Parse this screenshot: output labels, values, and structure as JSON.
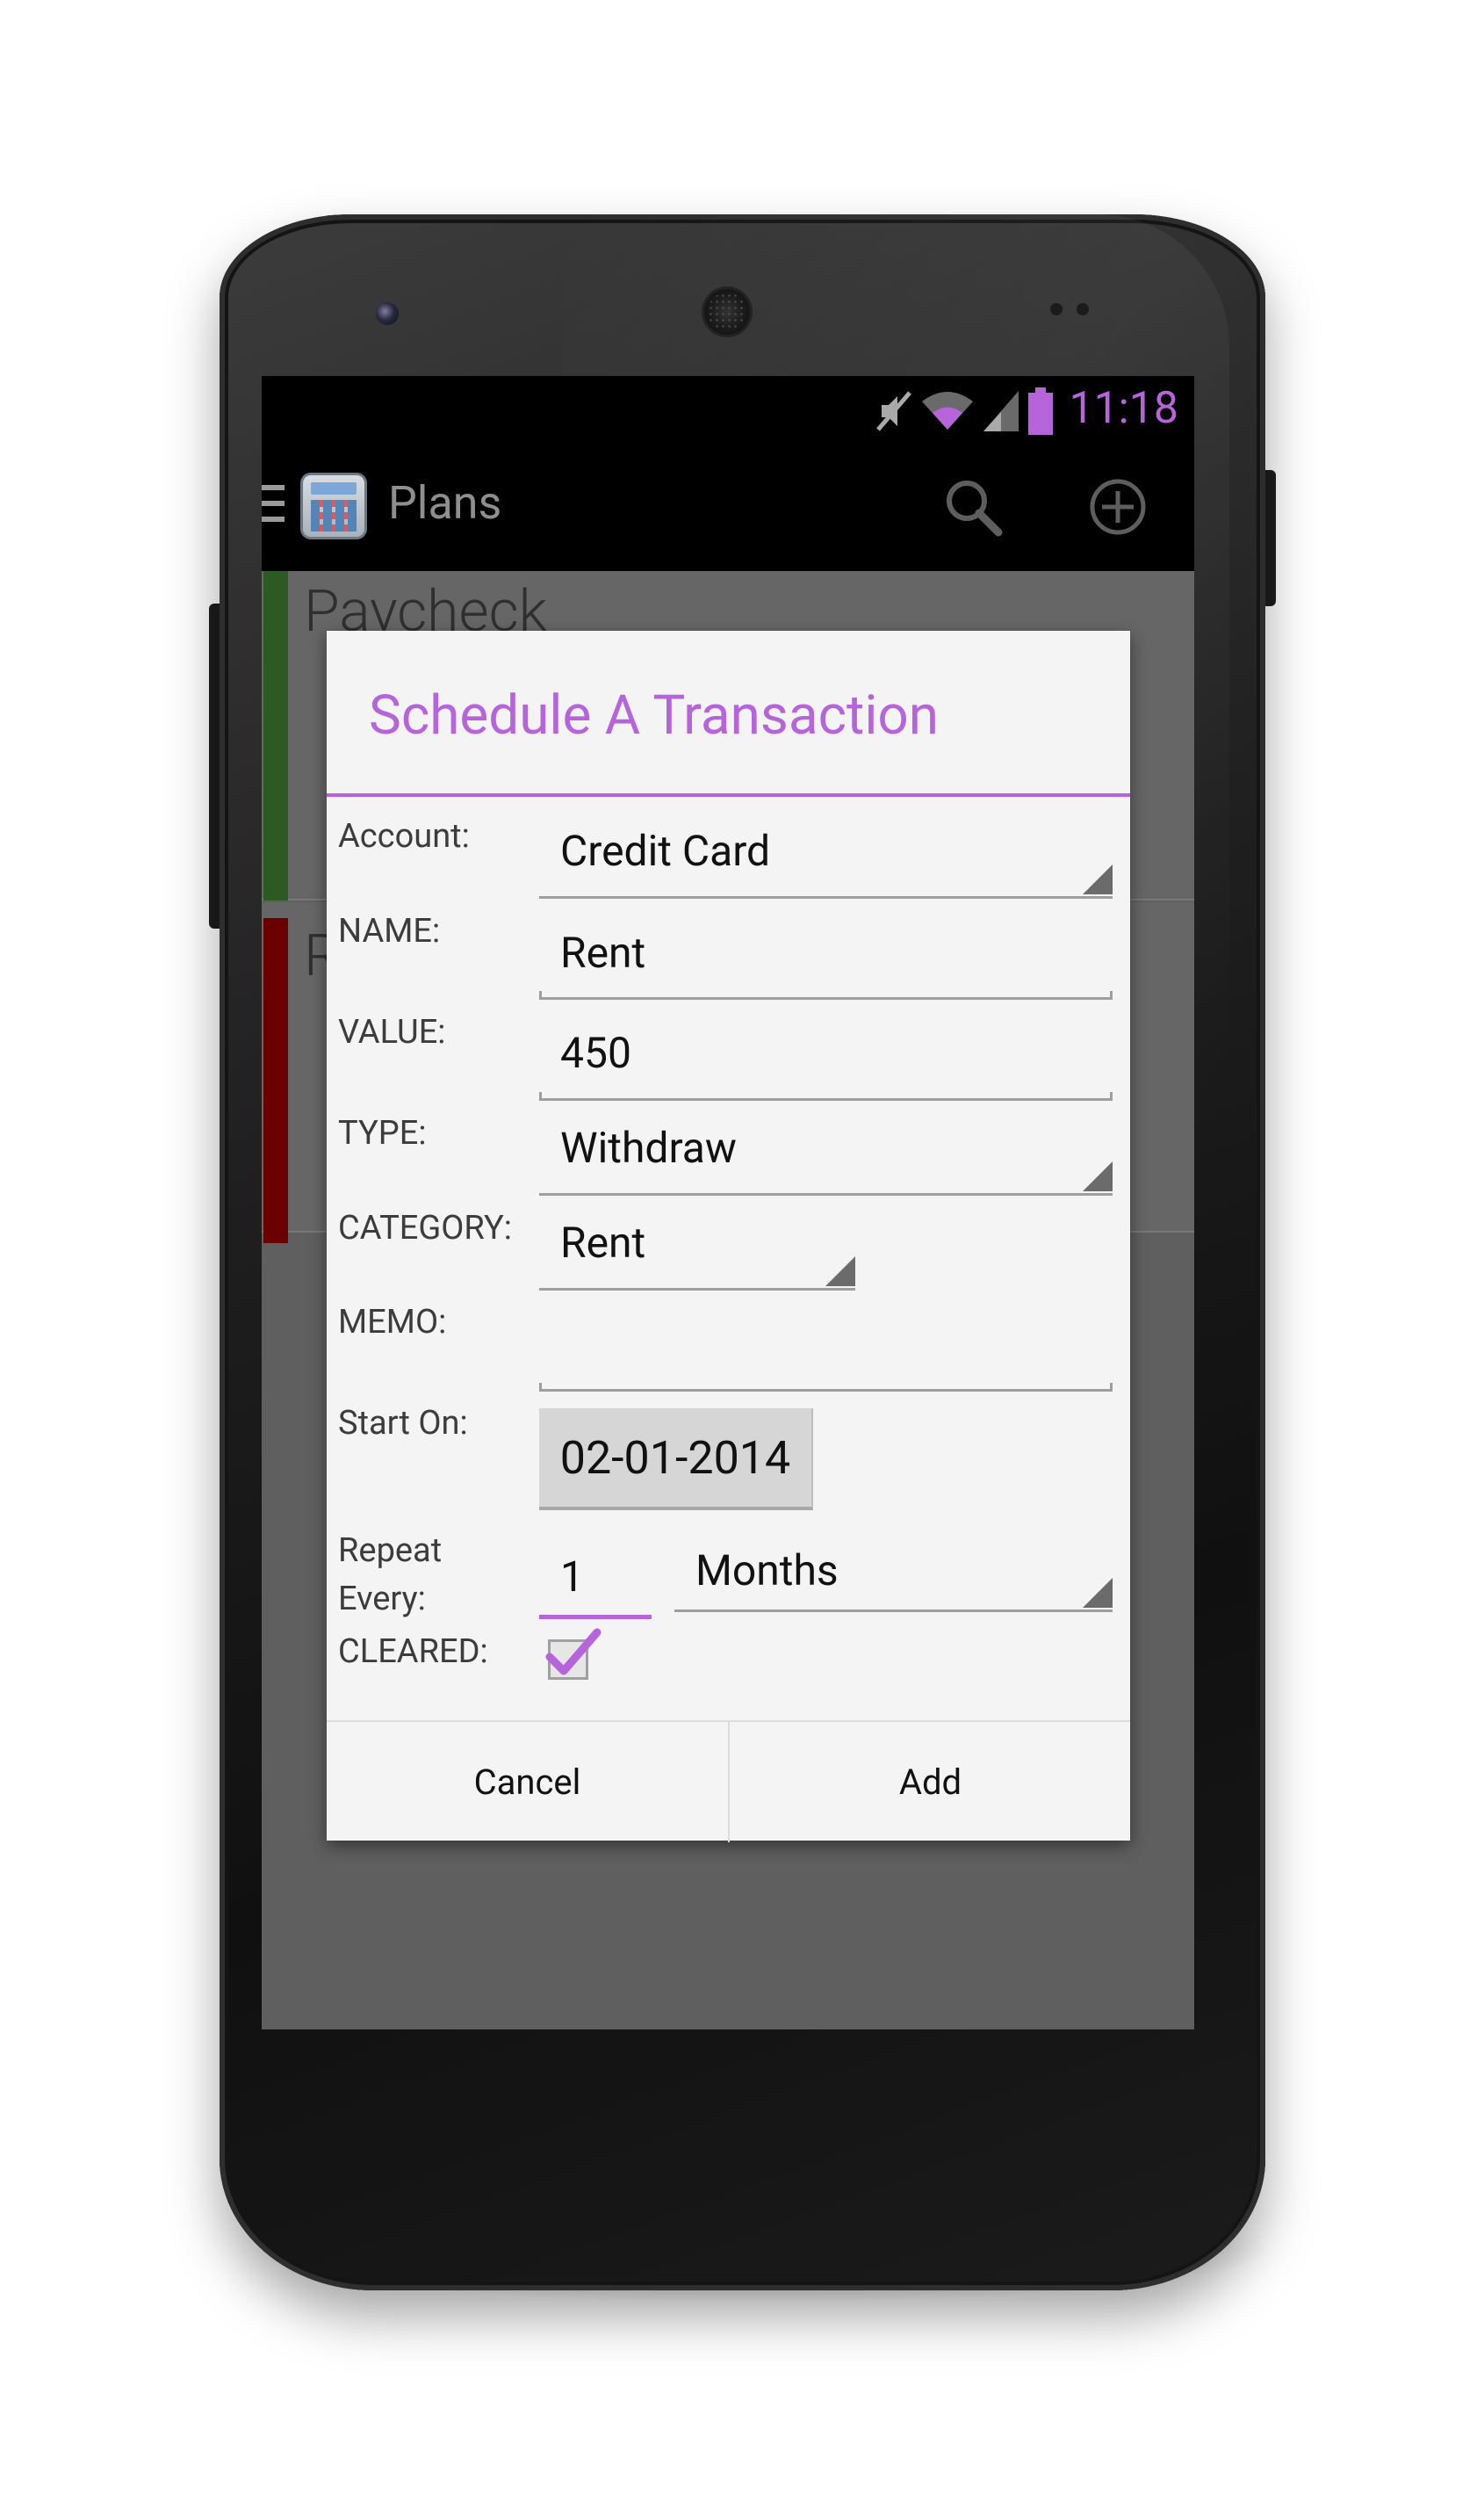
{
  "status_bar": {
    "time": "11:18",
    "icons": [
      "mute-icon",
      "wifi-icon",
      "signal-icon",
      "battery-icon"
    ]
  },
  "action_bar": {
    "title": "Plans",
    "icons": [
      "menu-icon",
      "app-calculator-icon",
      "search-icon",
      "add-circle-icon"
    ]
  },
  "background_list": {
    "items": [
      {
        "title": "Paycheck",
        "color": "#2c5a22"
      },
      {
        "title": "R",
        "color": "#6a0000"
      }
    ]
  },
  "dialog": {
    "title": "Schedule A Transaction",
    "fields": {
      "account": {
        "label": "Account:",
        "value": "Credit Card"
      },
      "name": {
        "label": "NAME:",
        "value": "Rent"
      },
      "value": {
        "label": "VALUE:",
        "value": "450"
      },
      "type": {
        "label": "TYPE:",
        "value": "Withdraw"
      },
      "category": {
        "label": "CATEGORY:",
        "value": "Rent"
      },
      "memo": {
        "label": "MEMO:",
        "value": ""
      },
      "start_on": {
        "label": "Start On:",
        "value": "02-01-2014"
      },
      "repeat": {
        "label_line1": "Repeat",
        "label_line2": "Every:",
        "count": "1",
        "unit": "Months"
      },
      "cleared": {
        "label": "CLEARED:",
        "checked": true
      }
    },
    "buttons": {
      "cancel": "Cancel",
      "add": "Add"
    }
  },
  "colors": {
    "accent": "#b565d9",
    "background_dim": "#5f5f5f",
    "dialog_bg": "#f4f4f4"
  }
}
